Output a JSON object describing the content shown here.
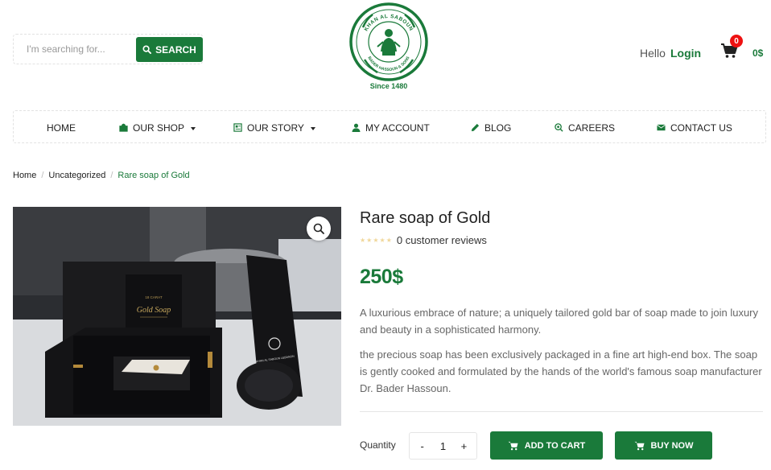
{
  "search": {
    "placeholder": "I'm searching for...",
    "button_label": "SEARCH"
  },
  "logo": {
    "since": "Since 1480",
    "ring_text_top": "KHAN AL SABOUN",
    "ring_text_bottom": "BADER HASSOUN & SONS",
    "arabic_top": "خان الصابون",
    "arabic_bottom": "بدر حسون وأولاده"
  },
  "account": {
    "hello": "Hello",
    "login": "Login"
  },
  "cart": {
    "count": "0",
    "total": "0$"
  },
  "nav": [
    {
      "label": "HOME",
      "icon": "none"
    },
    {
      "label": "OUR SHOP",
      "icon": "shopping-bag-icon",
      "dropdown": true
    },
    {
      "label": "OUR STORY",
      "icon": "book-icon",
      "dropdown": true
    },
    {
      "label": "MY ACCOUNT",
      "icon": "user-icon"
    },
    {
      "label": "BLOG",
      "icon": "pencil-icon"
    },
    {
      "label": "CAREERS",
      "icon": "search-icon"
    },
    {
      "label": "CONTACT US",
      "icon": "envelope-icon"
    }
  ],
  "breadcrumb": {
    "home": "Home",
    "category": "Uncategorized",
    "current": "Rare soap of Gold"
  },
  "product": {
    "title": "Rare soap of Gold",
    "rating_stars": 0,
    "reviews": "0 customer reviews",
    "price": "250",
    "currency": "$",
    "description_1": "A luxurious embrace of nature; a uniquely tailored gold bar of soap made to join luxury and beauty in a sophisticated harmony.",
    "description_2": "the precious soap has been exclusively packaged in a fine art high-end box. The soap is gently cooked and formulated by the hands of the world's famous soap manufacturer Dr. Bader Hassoun.",
    "image": {
      "box_label_small": "18 CARAT",
      "box_label": "Gold Soap",
      "card_label": "KHAN AL SABOUN LEBANON"
    }
  },
  "purchase": {
    "quantity_label": "Quantity",
    "quantity": "1",
    "minus": "-",
    "plus": "+",
    "add_to_cart": "ADD TO CART",
    "buy_now": "BUY NOW"
  },
  "colors": {
    "brand_green": "#1a7a3a",
    "badge_red": "#ee1111",
    "star_empty": "#f0d79a"
  }
}
